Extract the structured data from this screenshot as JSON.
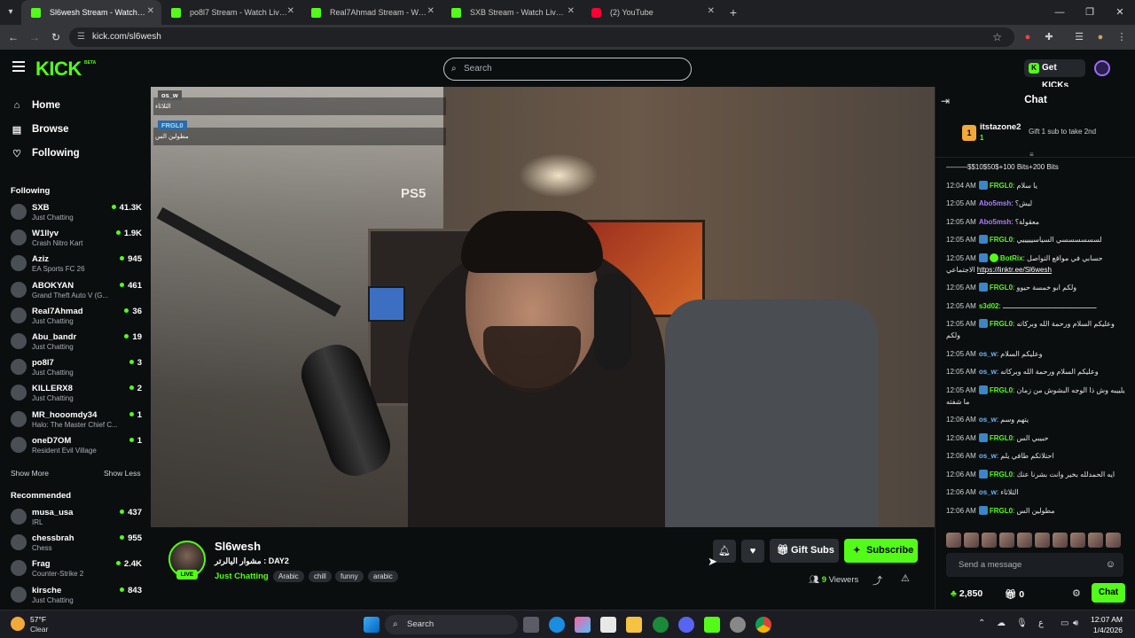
{
  "browser": {
    "tabs": [
      {
        "title": "Sl6wesh Stream - Watch Live on Kick",
        "icon": "kick-icon",
        "active": true
      },
      {
        "title": "po8l7 Stream - Watch Live on Kick",
        "icon": "kick-icon"
      },
      {
        "title": "Real7Ahmad Stream - Watch Live on Kick",
        "icon": "kick-icon"
      },
      {
        "title": "SXB Stream - Watch Live on Kick",
        "icon": "kick-icon"
      },
      {
        "title": "(2) YouTube",
        "icon": "youtube-icon"
      }
    ],
    "url": "kick.com/sl6wesh"
  },
  "header": {
    "logo": "KICK",
    "logo_badge": "BETA",
    "search_placeholder": "Search",
    "get_kicks_label": "Get KICKs"
  },
  "sidebar": {
    "nav": [
      {
        "label": "Home",
        "icon": "home-icon"
      },
      {
        "label": "Browse",
        "icon": "browse-icon"
      },
      {
        "label": "Following",
        "icon": "heart-icon"
      }
    ],
    "following_heading": "Following",
    "following": [
      {
        "name": "SXB",
        "category": "Just Chatting",
        "viewers": "41.3K"
      },
      {
        "name": "W1llyv",
        "category": "Crash Nitro Kart",
        "viewers": "1.9K"
      },
      {
        "name": "Aziz",
        "category": "EA Sports FC 26",
        "viewers": "945"
      },
      {
        "name": "ABOKYAN",
        "category": "Grand Theft Auto V (G...",
        "viewers": "461"
      },
      {
        "name": "Real7Ahmad",
        "category": "Just Chatting",
        "viewers": "36"
      },
      {
        "name": "Abu_bandr",
        "category": "Just Chatting",
        "viewers": "19"
      },
      {
        "name": "po8l7",
        "category": "Just Chatting",
        "viewers": "3"
      },
      {
        "name": "KILLERX8",
        "category": "Just Chatting",
        "viewers": "2"
      },
      {
        "name": "MR_hooomdy34",
        "category": "Halo: The Master Chief C...",
        "viewers": "1"
      },
      {
        "name": "oneD7OM",
        "category": "Resident Evil Village",
        "viewers": "1"
      }
    ],
    "show_more": "Show More",
    "show_less": "Show Less",
    "recommended_heading": "Recommended",
    "recommended": [
      {
        "name": "musa_usa",
        "category": "IRL",
        "viewers": "437"
      },
      {
        "name": "chessbrah",
        "category": "Chess",
        "viewers": "955"
      },
      {
        "name": "Frag",
        "category": "Counter-Strike 2",
        "viewers": "2.4K"
      },
      {
        "name": "kirsche",
        "category": "Just Chatting",
        "viewers": "843"
      }
    ]
  },
  "video": {
    "overlay_chat": [
      {
        "user": "os_w",
        "message": "الثلاثاء"
      },
      {
        "user": "FRGL0",
        "message": "مطولين الس"
      }
    ],
    "scene_text": "PS5"
  },
  "stream": {
    "channel": "Sl6wesh",
    "live_label": "LIVE",
    "title": "مشوار اليالرتر : DAY2",
    "category": "Just Chatting",
    "tags": [
      "Arabic",
      "chill",
      "funny",
      "arabic"
    ],
    "gift_label": "Gift Subs",
    "subscribe_label": "Subscribe",
    "viewers_count": "9",
    "viewers_label": "Viewers"
  },
  "chat": {
    "title": "Chat",
    "pinned": {
      "rank": "1",
      "user": "itstazone2",
      "count": "1",
      "tip": "Gift 1 sub to take 2nd"
    },
    "messages": [
      {
        "time": "",
        "user": "",
        "text": "———$$10$50$+100 Bits+200 Bits",
        "color": "#e6e6e6"
      },
      {
        "time": "12:04 AM",
        "user": "FRGL0",
        "text": "يا سلام",
        "color": "#53fc18",
        "badge": true
      },
      {
        "time": "12:05 AM",
        "user": "Abo5msh",
        "text": "ليش؟",
        "color": "#a97cff"
      },
      {
        "time": "12:05 AM",
        "user": "Abo5msh",
        "text": "معقولة؟",
        "color": "#a97cff"
      },
      {
        "time": "12:05 AM",
        "user": "FRGL0",
        "text": "لسسسسسسي السياسيييييي",
        "color": "#53fc18",
        "badge": true
      },
      {
        "time": "12:05 AM",
        "user": "BotRix",
        "text": "حسابي في مواقع التواصل الاجتماعي",
        "link": "https://linktr.ee/Sl6wesh",
        "color": "#53fc18",
        "badge": true,
        "verified": true
      },
      {
        "time": "12:05 AM",
        "user": "FRGL0",
        "text": "ولكم ابو خمسة حيوو",
        "color": "#53fc18",
        "badge": true
      },
      {
        "time": "12:05 AM",
        "user": "s3d02",
        "text": "ـــــــــــــــــــــــــــــــــــــــــــــ",
        "color": "#53fc18"
      },
      {
        "time": "12:05 AM",
        "user": "FRGL0",
        "text": "وعليكم السلام ورحمة الله وبركاته ولكم",
        "color": "#53fc18",
        "badge": true
      },
      {
        "time": "12:05 AM",
        "user": "os_w",
        "text": "وعليكم السلام",
        "color": "#6fb6ff"
      },
      {
        "time": "12:05 AM",
        "user": "os_w",
        "text": "وعليكم السلام ورحمة الله وبركاته",
        "color": "#6fb6ff"
      },
      {
        "time": "12:05 AM",
        "user": "FRGL0",
        "text": "يلييبه وش ذا الوجه البشوش من زمان ما شفته",
        "color": "#53fc18",
        "badge": true
      },
      {
        "time": "12:06 AM",
        "user": "os_w",
        "text": "يتهم وسم",
        "color": "#6fb6ff"
      },
      {
        "time": "12:06 AM",
        "user": "FRGL0",
        "text": "حبيبي الس",
        "color": "#53fc18",
        "badge": true
      },
      {
        "time": "12:06 AM",
        "user": "os_w",
        "text": "احتلاتكم طافي يلم",
        "color": "#6fb6ff"
      },
      {
        "time": "12:06 AM",
        "user": "FRGL0",
        "text": "ايه الحمدلله بخير وانت بشرنا عنك",
        "color": "#53fc18",
        "badge": true
      },
      {
        "time": "12:06 AM",
        "user": "os_w",
        "text": "الثلاثاء",
        "color": "#6fb6ff"
      },
      {
        "time": "12:06 AM",
        "user": "FRGL0",
        "text": "مطولين الس",
        "color": "#53fc18",
        "badge": true
      }
    ],
    "input_placeholder": "Send a message",
    "kicks_balance": "2,850",
    "gift_balance": "0",
    "send_label": "Chat"
  },
  "taskbar": {
    "temperature": "57°F",
    "condition": "Clear",
    "search_label": "Search",
    "time": "12:07 AM",
    "date": "1/4/2026"
  },
  "colors": {
    "accent": "#53fc18",
    "background": "#0b0e0f",
    "surface": "#2a2e33"
  }
}
